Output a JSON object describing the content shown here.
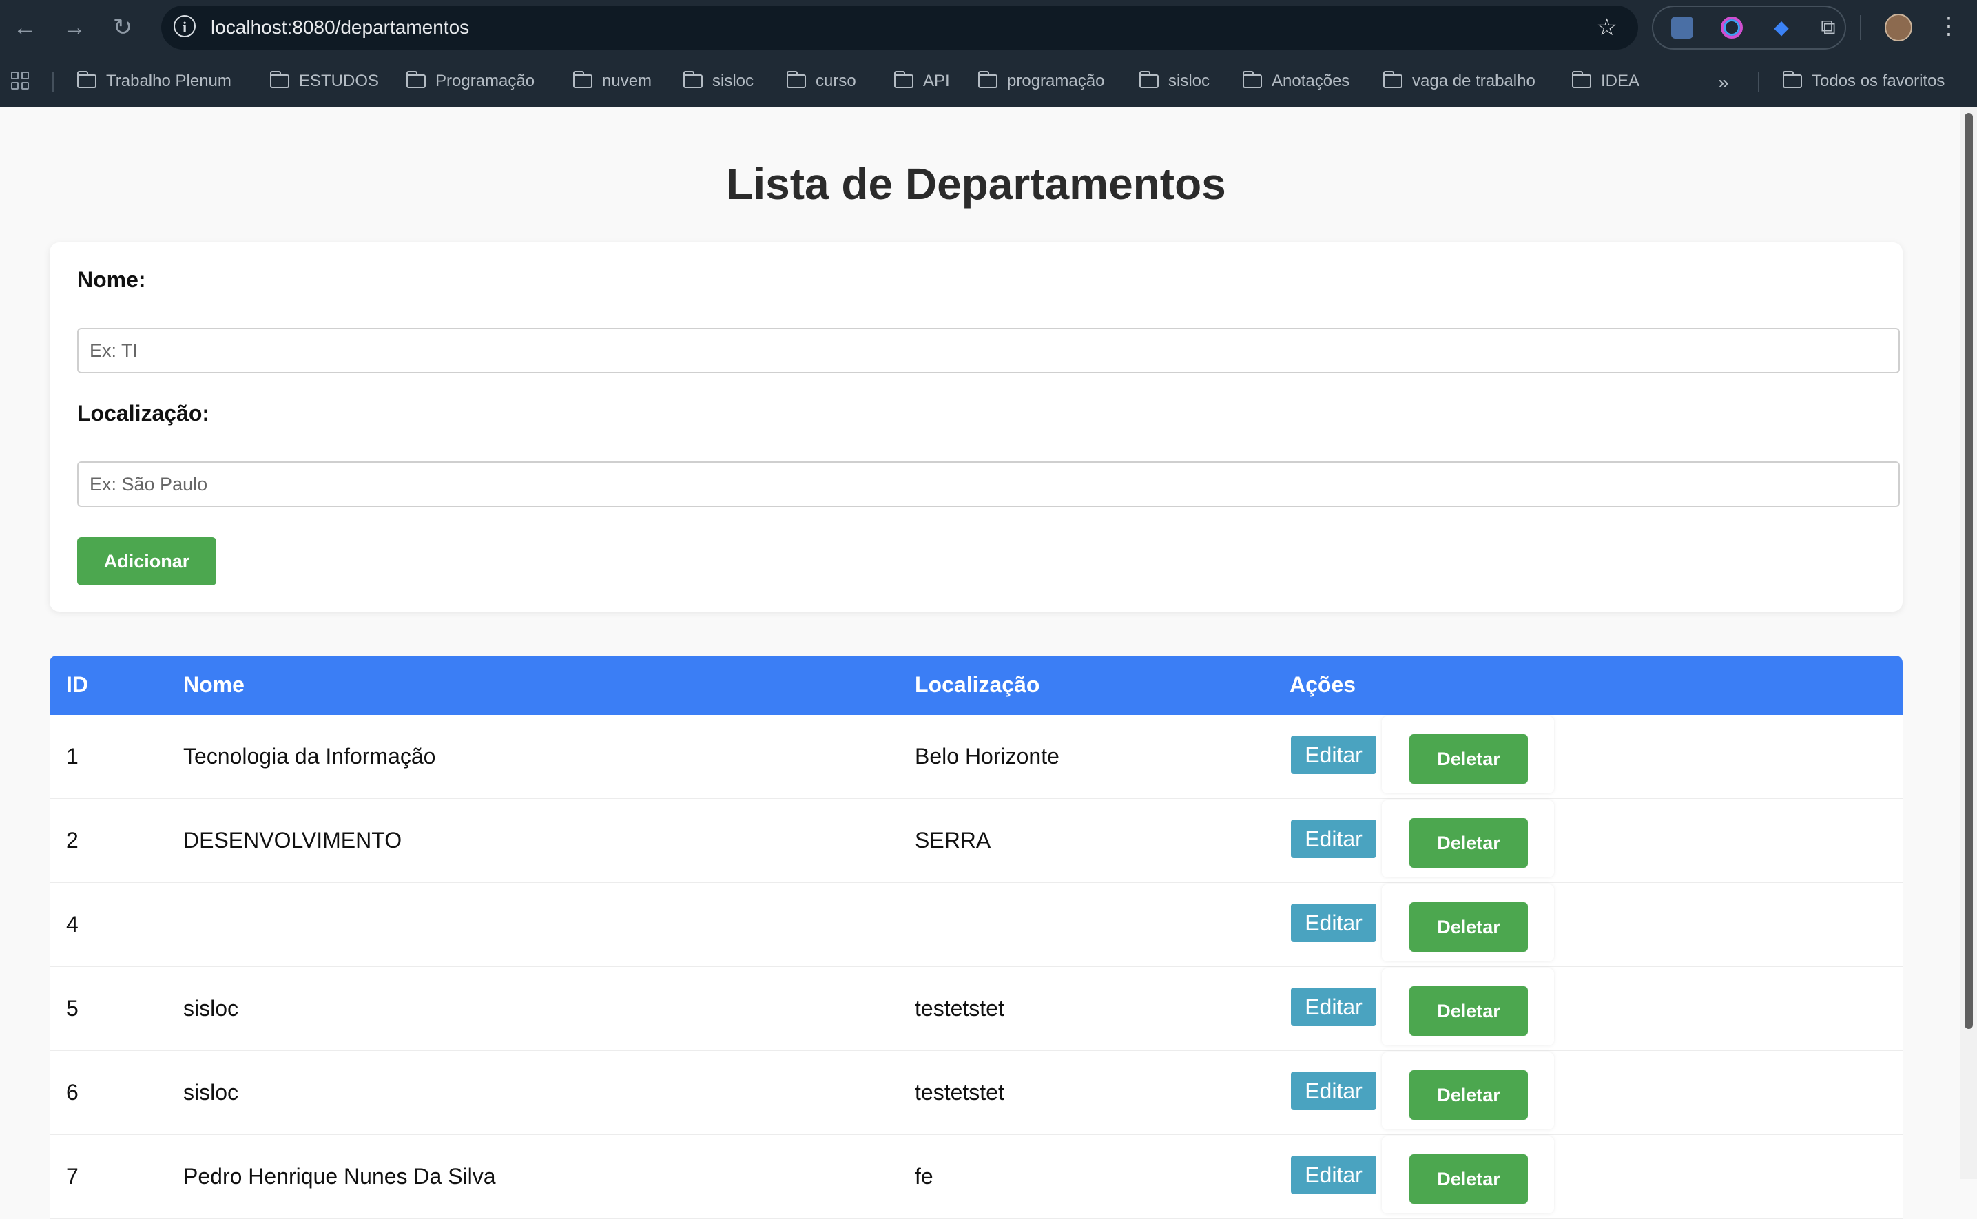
{
  "browser": {
    "url": "localhost:8080/departamentos",
    "bookmarks": [
      "Trabalho Plenum",
      "ESTUDOS",
      "Programação",
      "nuvem",
      "sisloc",
      "curso",
      "API",
      "programação",
      "sisloc",
      "Anotações",
      "vaga de trabalho",
      "IDEA"
    ],
    "more_label": "»",
    "all_favorites": "Todos os favoritos"
  },
  "page": {
    "title": "Lista de Departamentos"
  },
  "form": {
    "nome_label": "Nome:",
    "nome_placeholder": "Ex: TI",
    "localizacao_label": "Localização:",
    "localizacao_placeholder": "Ex: São Paulo",
    "add_button": "Adicionar"
  },
  "table": {
    "headers": [
      "ID",
      "Nome",
      "Localização",
      "Ações"
    ],
    "rows": [
      {
        "id": "1",
        "nome": "Tecnologia da Informação",
        "localizacao": "Belo Horizonte"
      },
      {
        "id": "2",
        "nome": "DESENVOLVIMENTO",
        "localizacao": "SERRA"
      },
      {
        "id": "4",
        "nome": "",
        "localizacao": ""
      },
      {
        "id": "5",
        "nome": "sisloc",
        "localizacao": "testetstet"
      },
      {
        "id": "6",
        "nome": "sisloc",
        "localizacao": "testetstet"
      },
      {
        "id": "7",
        "nome": "Pedro Henrique Nunes Da Silva",
        "localizacao": "fe"
      }
    ],
    "edit_label": "Editar",
    "delete_label": "Deletar"
  },
  "icons": {
    "back": "arrow-left-icon",
    "forward": "arrow-right-icon",
    "reload": "reload-icon",
    "info": "info-icon",
    "star": "star-icon",
    "apps": "apps-grid-icon",
    "folder": "folder-icon",
    "menu": "kebab-menu-icon"
  },
  "colors": {
    "table_header": "#3b7ef5",
    "primary_button": "#4ca74f",
    "edit_button": "#4aa3c0"
  }
}
